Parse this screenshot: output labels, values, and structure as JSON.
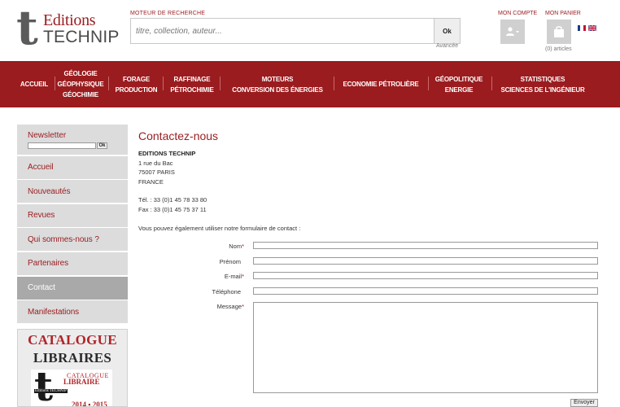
{
  "header": {
    "logo": {
      "line1": "Editions",
      "line2": "TECHNIP",
      "mark": "t"
    },
    "search": {
      "label": "MOTEUR DE RECHERCHE",
      "placeholder": "titre, collection, auteur...",
      "button": "Ok",
      "advanced": "Avancée"
    },
    "account": {
      "label": "MON COMPTE",
      "icon": "user-icon"
    },
    "cart": {
      "label": "MON PANIER",
      "icon": "bag-icon",
      "count": "(0) articles"
    },
    "languages": [
      {
        "code": "fr"
      },
      {
        "code": "en"
      }
    ]
  },
  "nav": {
    "items": [
      {
        "line1": "ACCUEIL",
        "line2": "",
        "line3": ""
      },
      {
        "line1": "GÉOLOGIE",
        "line2": "GÉOPHYSIQUE",
        "line3": "GÉOCHIMIE"
      },
      {
        "line1": "FORAGE",
        "line2": "PRODUCTION",
        "line3": ""
      },
      {
        "line1": "RAFFINAGE",
        "line2": "PÉTROCHIMIE",
        "line3": ""
      },
      {
        "line1": "MOTEURS",
        "line2": "CONVERSION DES ÉNERGIES",
        "line3": ""
      },
      {
        "line1": "ECONOMIE PÉTROLIÈRE",
        "line2": "",
        "line3": ""
      },
      {
        "line1": "GÉOPOLITIQUE",
        "line2": "ENERGIE",
        "line3": ""
      },
      {
        "line1": "STATISTIQUES",
        "line2": "SCIENCES DE L'INGÉNIEUR",
        "line3": ""
      }
    ]
  },
  "sidebar": {
    "newsletter": {
      "label": "Newsletter",
      "button": "Ok"
    },
    "items": [
      {
        "label": "Accueil"
      },
      {
        "label": "Nouveautés"
      },
      {
        "label": "Revues"
      },
      {
        "label": "Qui sommes-nous ?"
      },
      {
        "label": "Partenaires"
      },
      {
        "label": "Contact"
      },
      {
        "label": "Manifestations"
      }
    ],
    "catalogue": {
      "title1": "CATALOGUE",
      "title2": "LIBRAIRES",
      "cover_line1": "CATALOGUE",
      "cover_line2": "LIBRAIRE",
      "cover_publisher": "Editions TECHNIP",
      "cover_years": "2014 ▪ 2015"
    }
  },
  "main": {
    "title": "Contactez-nous",
    "company": "EDITIONS TECHNIP",
    "address": [
      "1 rue du Bac",
      "75007 PARIS",
      "FRANCE"
    ],
    "tel": "Tél. : 33 (0)1 45 78 33 80",
    "fax": "Fax : 33 (0)1 45 75 37 11",
    "intro": "Vous pouvez également utiliser notre formulaire de contact :",
    "form": {
      "name": "Nom",
      "firstname": "Prénom",
      "email": "E-mail",
      "phone": "Téléphone",
      "message": "Message",
      "required_mark": "*",
      "submit": "Envoyer"
    }
  },
  "colors": {
    "brand": "#9a1c1f",
    "sidebar": "#dcdcdc",
    "sidebar_active": "#a9a9a9"
  }
}
